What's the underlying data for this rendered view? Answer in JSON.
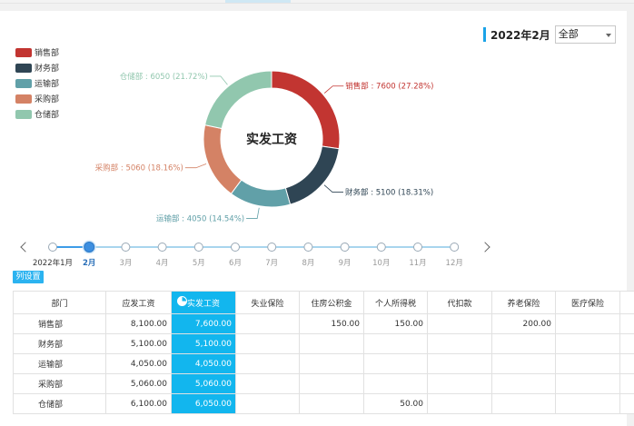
{
  "filter": {
    "month_label": "2022年2月",
    "scope_value": "全部"
  },
  "chart_data": {
    "type": "pie",
    "center_label": "实发工资",
    "slices": [
      {
        "name": "销售部",
        "value": 7600,
        "percent": "27.28%",
        "color": "#c23531"
      },
      {
        "name": "财务部",
        "value": 5100,
        "percent": "18.31%",
        "color": "#2f4554"
      },
      {
        "name": "运输部",
        "value": 4050,
        "percent": "14.54%",
        "color": "#61a0a8"
      },
      {
        "name": "采购部",
        "value": 5060,
        "percent": "18.16%",
        "color": "#d48265"
      },
      {
        "name": "仓储部",
        "value": 6050,
        "percent": "21.72%",
        "color": "#91c7ae"
      }
    ],
    "slice_labels": [
      "销售部 : 7600 (27.28%)",
      "财务部 : 5100 (18.31%)",
      "运输部 : 4050 (14.54%)",
      "采购部 : 5060 (18.16%)",
      "仓储部 : 6050 (21.72%)"
    ]
  },
  "timeline": {
    "months": [
      "2022年1月",
      "2月",
      "3月",
      "4月",
      "5月",
      "6月",
      "7月",
      "8月",
      "9月",
      "10月",
      "11月",
      "12月"
    ],
    "selected_index": 1
  },
  "colset_label": "列设置",
  "table": {
    "headers": [
      "部门",
      "应发工资",
      "实发工资",
      "失业保险",
      "住房公积金",
      "个人所得税",
      "代扣款",
      "养老保险",
      "医疗保险",
      ""
    ],
    "rows": [
      [
        "销售部",
        "8,100.00",
        "7,600.00",
        "",
        "150.00",
        "150.00",
        "",
        "200.00",
        "",
        ""
      ],
      [
        "财务部",
        "5,100.00",
        "5,100.00",
        "",
        "",
        "",
        "",
        "",
        "",
        ""
      ],
      [
        "运输部",
        "4,050.00",
        "4,050.00",
        "",
        "",
        "",
        "",
        "",
        "",
        ""
      ],
      [
        "采购部",
        "5,060.00",
        "5,060.00",
        "",
        "",
        "",
        "",
        "",
        "",
        ""
      ],
      [
        "仓储部",
        "6,100.00",
        "6,050.00",
        "",
        "",
        "50.00",
        "",
        "",
        "",
        ""
      ]
    ]
  }
}
